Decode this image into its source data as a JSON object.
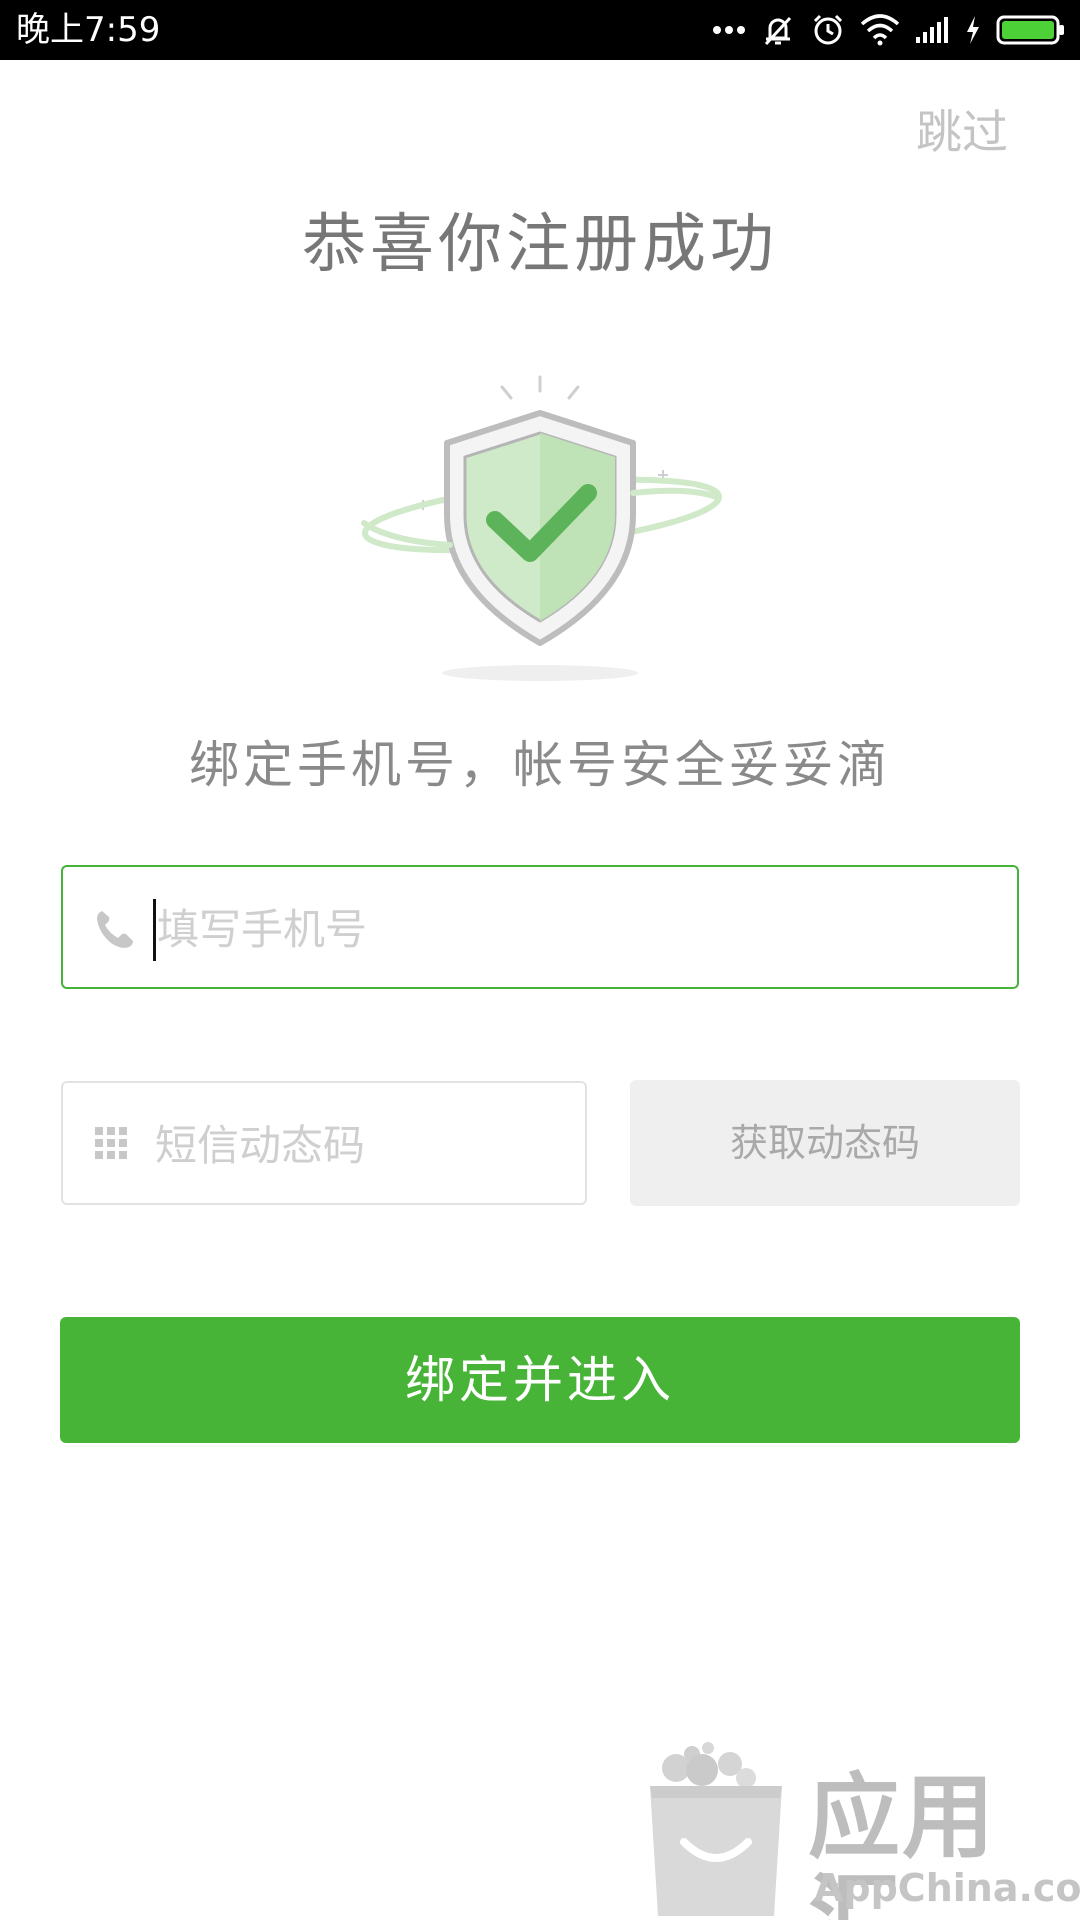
{
  "status_bar": {
    "time": "晚上7:59",
    "icons": [
      "more-dots-icon",
      "mute-icon",
      "alarm-icon",
      "wifi-icon",
      "signal-icon",
      "charging-icon",
      "battery-icon"
    ]
  },
  "header": {
    "skip_label": "跳过"
  },
  "main": {
    "title": "恭喜你注册成功",
    "illustration": "shield-check-icon",
    "subtitle": "绑定手机号，帐号安全妥妥滴"
  },
  "form": {
    "phone_placeholder": "填写手机号",
    "code_placeholder": "短信动态码",
    "get_code_label": "获取动态码",
    "submit_label": "绑定并进入"
  },
  "watermark": {
    "brand_cn": "应用汇",
    "brand_en": "AppChina.com"
  },
  "colors": {
    "accent": "#47b437",
    "focus_border": "#45b23a",
    "disabled_bg": "#efefef"
  }
}
